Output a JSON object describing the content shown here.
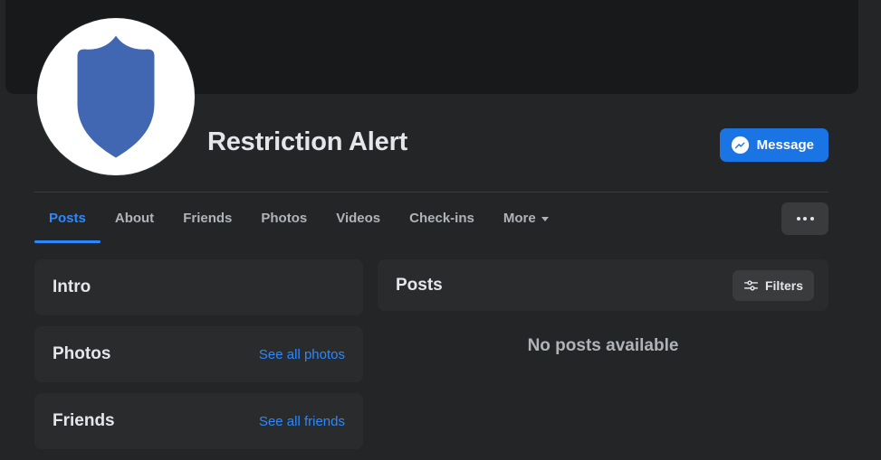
{
  "profile": {
    "name": "Restriction Alert",
    "avatar_icon": "shield-icon",
    "avatar_shield_color": "#4267b2",
    "avatar_background": "#ffffff",
    "cover_color": "#18191a"
  },
  "actions": {
    "message_label": "Message",
    "message_icon": "messenger-icon",
    "message_color": "#1b74e4",
    "more_icon": "ellipsis-icon"
  },
  "tabs": [
    {
      "label": "Posts",
      "active": true
    },
    {
      "label": "About",
      "active": false
    },
    {
      "label": "Friends",
      "active": false
    },
    {
      "label": "Photos",
      "active": false
    },
    {
      "label": "Videos",
      "active": false
    },
    {
      "label": "Check-ins",
      "active": false
    },
    {
      "label": "More",
      "active": false,
      "caret": true
    }
  ],
  "sidebar": {
    "cards": [
      {
        "title": "Intro",
        "link": ""
      },
      {
        "title": "Photos",
        "link": "See all photos"
      },
      {
        "title": "Friends",
        "link": "See all friends"
      }
    ]
  },
  "posts": {
    "title": "Posts",
    "filters_label": "Filters",
    "filters_icon": "sliders-icon",
    "empty_message": "No posts available"
  },
  "theme": {
    "page_background": "#242526",
    "card_background": "#2a2b2d",
    "accent_blue": "#2d88ff",
    "link_blue": "#2d88ff",
    "primary_text": "#e4e6eb",
    "secondary_text": "#b0b3b8"
  }
}
